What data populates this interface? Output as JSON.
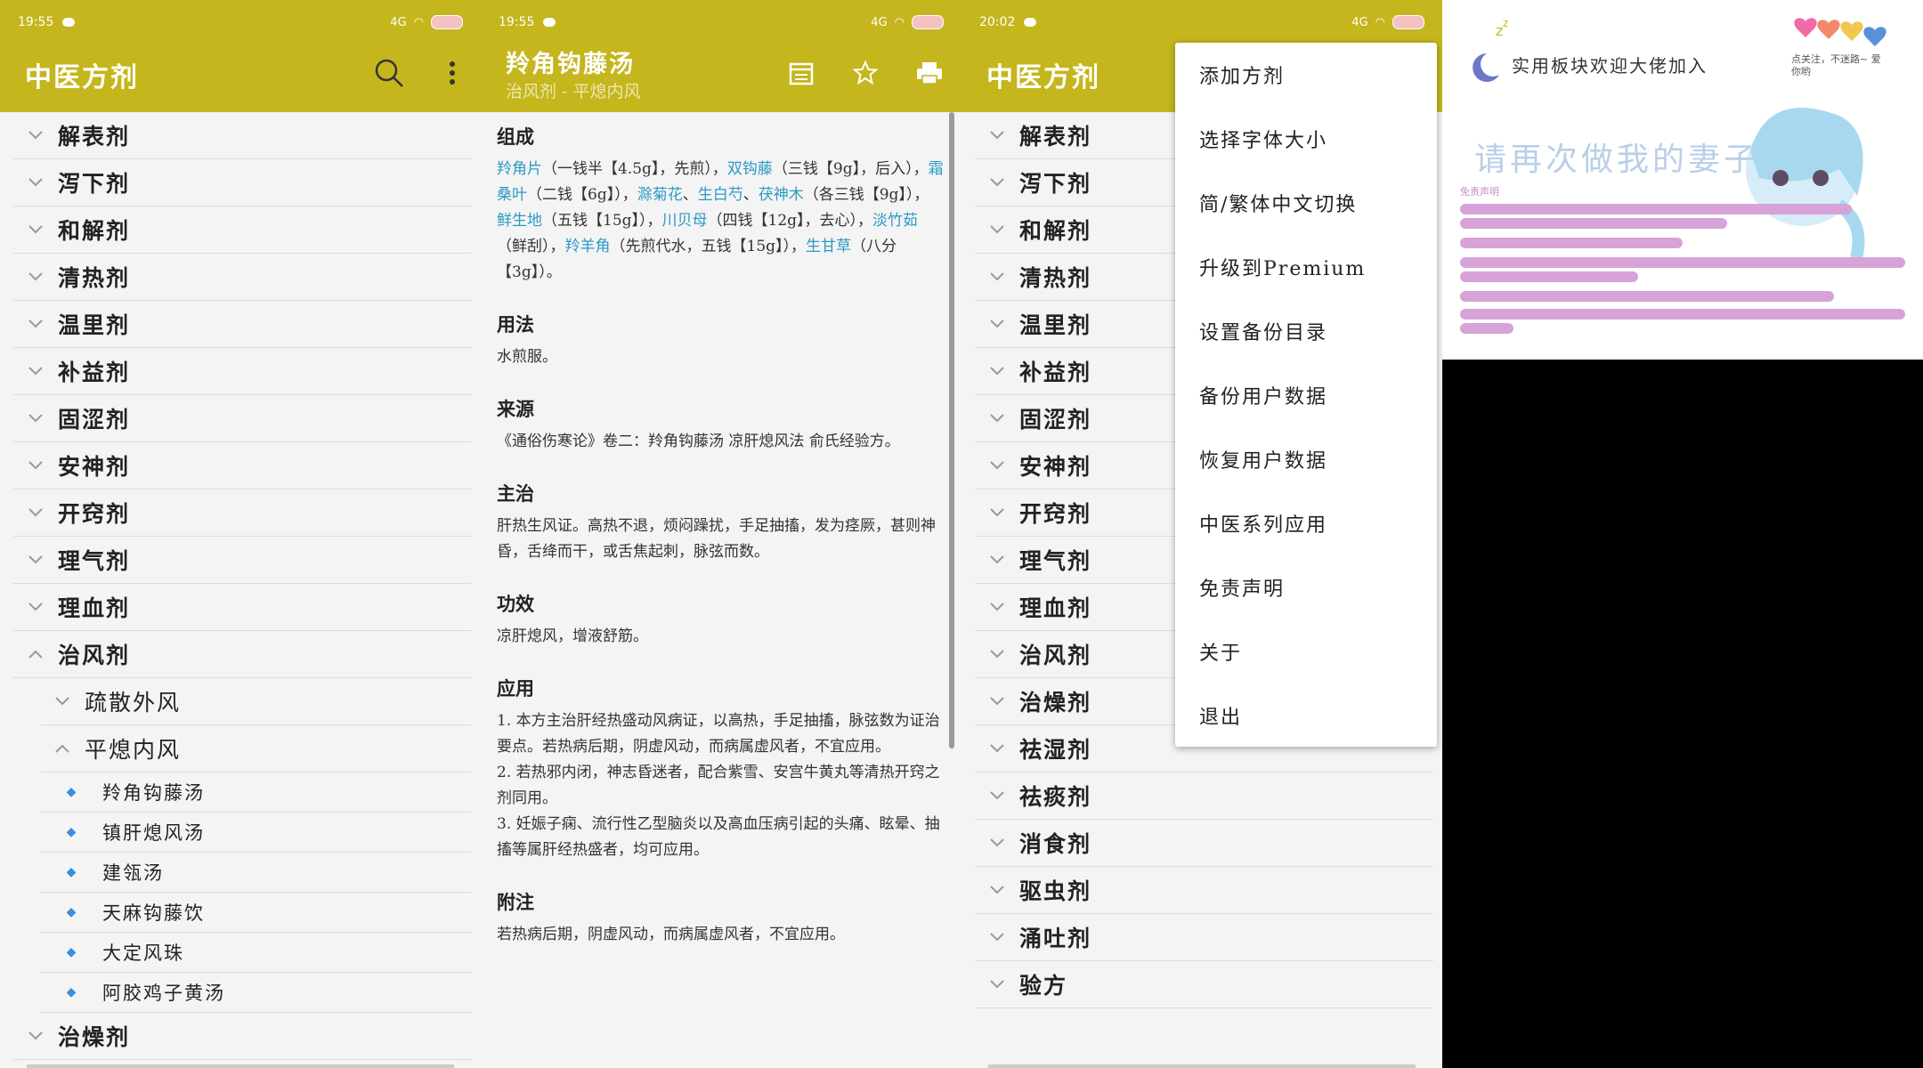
{
  "panel1": {
    "status_time": "19:55",
    "status_net": "4G",
    "title": "中医方剂",
    "categories": [
      "解表剂",
      "泻下剂",
      "和解剂",
      "清热剂",
      "温里剂",
      "补益剂",
      "固涩剂",
      "安神剂",
      "开窍剂",
      "理气剂",
      "理血剂"
    ],
    "expanded_category": "治风剂",
    "subcategories": [
      "疏散外风",
      "平熄内风"
    ],
    "formulas": [
      "羚角钩藤汤",
      "镇肝熄风汤",
      "建瓴汤",
      "天麻钩藤饮",
      "大定风珠",
      "阿胶鸡子黄汤"
    ],
    "after_category": "治燥剂"
  },
  "panel2": {
    "status_time": "19:55",
    "status_net": "4G",
    "title": "羚角钩藤汤",
    "subtitle": "治风剂 - 平熄内风",
    "sections": {
      "composition_h": "组成",
      "composition": [
        {
          "t": "羚角片",
          "h": true
        },
        {
          "t": "（一钱半【4.5g】，先煎），",
          "h": false
        },
        {
          "t": "双钩藤",
          "h": true
        },
        {
          "t": "（三钱【9g】，后入），",
          "h": false
        },
        {
          "t": "霜桑叶",
          "h": true
        },
        {
          "t": "（二钱【6g】），",
          "h": false
        },
        {
          "t": "滁菊花",
          "h": true
        },
        {
          "t": "、",
          "h": false
        },
        {
          "t": "生白芍",
          "h": true
        },
        {
          "t": "、",
          "h": false
        },
        {
          "t": "茯神木",
          "h": true
        },
        {
          "t": "（各三钱【9g】），",
          "h": false
        },
        {
          "t": "鲜生地",
          "h": true
        },
        {
          "t": "（五钱【15g】），",
          "h": false
        },
        {
          "t": "川贝母",
          "h": true
        },
        {
          "t": "（四钱【12g】，去心），",
          "h": false
        },
        {
          "t": "淡竹茹",
          "h": true
        },
        {
          "t": "（鲜刮），",
          "h": false
        },
        {
          "t": "羚羊角",
          "h": true
        },
        {
          "t": "（先煎代水，五钱【15g】），",
          "h": false
        },
        {
          "t": "生甘草",
          "h": true
        },
        {
          "t": "（八分【3g】）。",
          "h": false
        }
      ],
      "usage_h": "用法",
      "usage": "水煎服。",
      "source_h": "来源",
      "source": "《通俗伤寒论》卷二：羚角钩藤汤 凉肝熄风法 俞氏经验方。",
      "indication_h": "主治",
      "indication": "肝热生风证。高热不退，烦闷躁扰，手足抽搐，发为痉厥，甚则神昏，舌绛而干，或舌焦起刺，脉弦而数。",
      "effect_h": "功效",
      "effect": "凉肝熄风，增液舒筋。",
      "application_h": "应用",
      "application": [
        "1. 本方主治肝经热盛动风病证，以高热，手足抽搐，脉弦数为证治要点。若热病后期，阴虚风动，而病属虚风者，不宜应用。",
        "2. 若热邪内闭，神志昏迷者，配合紫雪、安宫牛黄丸等清热开窍之剂同用。",
        "3. 妊娠子痫、流行性乙型脑炎以及高血压病引起的头痛、眩晕、抽搐等属肝经热盛者，均可应用。"
      ],
      "notes_h": "附注",
      "notes": "若热病后期，阴虚风动，而病属虚风者，不宜应用。"
    }
  },
  "panel3": {
    "status_time": "20:02",
    "status_net": "4G",
    "title": "中医方剂",
    "categories": [
      "解表剂",
      "泻下剂",
      "和解剂",
      "清热剂",
      "温里剂",
      "补益剂",
      "固涩剂",
      "安神剂",
      "开窍剂",
      "理气剂",
      "理血剂",
      "治风剂",
      "治燥剂",
      "祛湿剂",
      "祛痰剂",
      "消食剂",
      "驱虫剂",
      "涌吐剂",
      "验方"
    ]
  },
  "menu": {
    "items": [
      "添加方剂",
      "选择字体大小",
      "简/繁体中文切换",
      "升级到Premium",
      "设置备份目录",
      "备份用户数据",
      "恢复用户数据",
      "中医系列应用",
      "免责声明",
      "关于",
      "退出"
    ]
  },
  "panel4": {
    "banner": "实用板块欢迎大佬加入",
    "handwritten": "请再次做我的妻子",
    "notice_title": "免责声明",
    "corner_note": "点关注，不迷路~ 爱你哟"
  },
  "colors": {
    "appbar": "#c4b61c",
    "herb": "#2b9ac4",
    "bullet": "#3a8fd8"
  }
}
